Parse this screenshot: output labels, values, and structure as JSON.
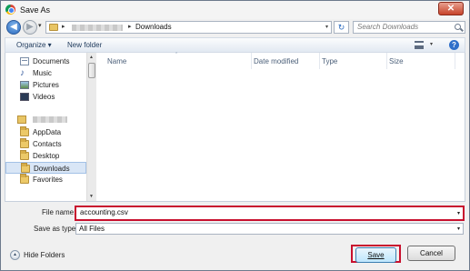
{
  "window": {
    "title": "Save As",
    "close_glyph": "✕",
    "app_icon": "chrome-icon"
  },
  "addressbar": {
    "back_glyph": "◀",
    "forward_glyph": "▶",
    "recent_glyph": "▾",
    "breadcrumb_sep": "▸",
    "current_folder": "Downloads",
    "refresh_glyph": "↻",
    "search_placeholder": "Search Downloads"
  },
  "toolbar": {
    "organize_label": "Organize ▾",
    "new_folder_label": "New folder",
    "view_dropdown_glyph": "▾",
    "help_glyph": "?"
  },
  "nav_pane": {
    "libraries": [
      {
        "label": "Documents",
        "icon": "documents-icon"
      },
      {
        "label": "Music",
        "icon": "music-icon"
      },
      {
        "label": "Pictures",
        "icon": "pictures-icon"
      },
      {
        "label": "Videos",
        "icon": "videos-icon"
      }
    ],
    "user_folders": [
      {
        "label": "AppData",
        "icon": "folder-icon"
      },
      {
        "label": "Contacts",
        "icon": "contacts-icon"
      },
      {
        "label": "Desktop",
        "icon": "desktop-icon"
      },
      {
        "label": "Downloads",
        "icon": "downloads-icon",
        "selected": true
      },
      {
        "label": "Favorites",
        "icon": "favorites-icon"
      }
    ]
  },
  "file_list": {
    "columns": [
      "Name",
      "Date modified",
      "Type",
      "Size"
    ]
  },
  "form": {
    "filename_label": "File name:",
    "filename_value": "accounting.csv",
    "savetype_label": "Save as type:",
    "savetype_value": "All Files",
    "dropdown_glyph": "▾"
  },
  "footer": {
    "hide_folders_label": "Hide Folders",
    "hide_folders_glyph": "▴",
    "save_label": "Save",
    "cancel_label": "Cancel"
  }
}
